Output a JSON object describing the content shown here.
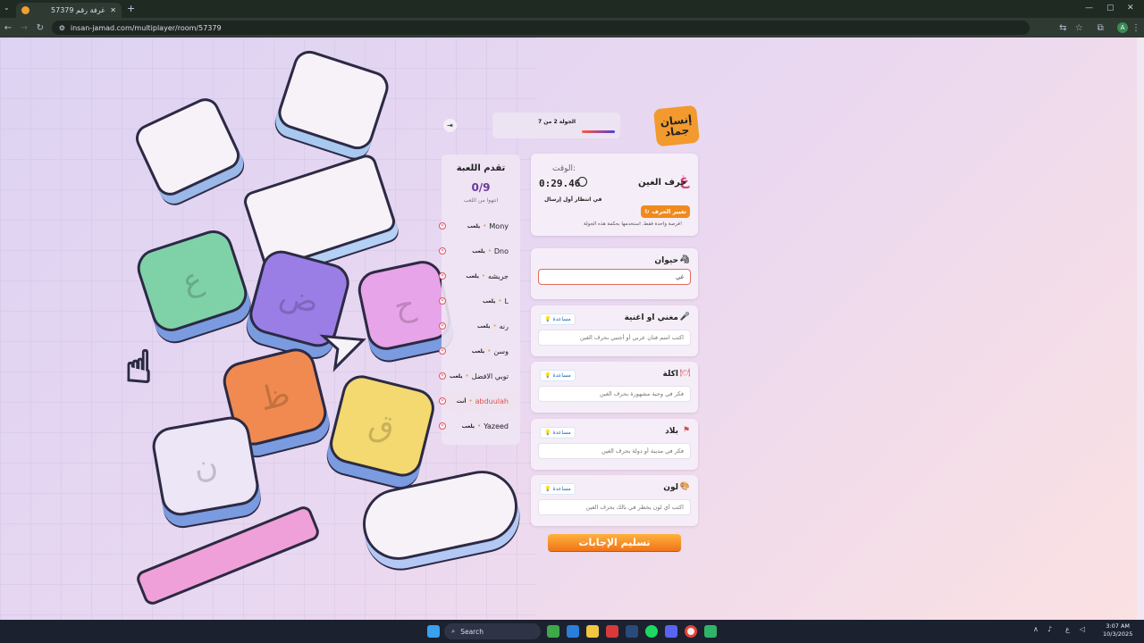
{
  "browser": {
    "tab_title": "غرفة رقم 57379",
    "url": "insan-jamad.com/multiplayer/room/57379",
    "avatar": "A"
  },
  "game": {
    "logo": "إنسان جماد",
    "round_label": "الجولة 2 من 7",
    "progress_title": "تقدم اللعبة",
    "progress_count": "0/9",
    "progress_sub": "انتهوا من اللعب",
    "players": [
      {
        "name": "Mony",
        "status": "يلعب"
      },
      {
        "name": "Dno",
        "status": "يلعب"
      },
      {
        "name": "جريشه",
        "status": "يلعب"
      },
      {
        "name": "L",
        "status": "يلعب"
      },
      {
        "name": "رنه",
        "status": "يلعب"
      },
      {
        "name": "وسن",
        "status": "يلعب"
      },
      {
        "name": "توبي الافضل",
        "status": "يلعب"
      },
      {
        "name": "abduulah",
        "status": "أنت"
      },
      {
        "name": "Yazeed",
        "status": "يلعب"
      }
    ],
    "time_label": "الوقت:",
    "time_value": "0:29.46",
    "letter_glyph": "غ",
    "letter_name": "حرف الغين",
    "waiting_text": "في انتظار أول إرسال",
    "change_letter": "تغيير الحرف",
    "change_note": "فرصة واحدة فقط. استخدمها بحكمة هذه الجولة!",
    "help_label": "مساعدة",
    "categories": [
      {
        "name": "حيوان",
        "value": "غي",
        "placeholder": ""
      },
      {
        "name": "مغني او اغنية",
        "value": "",
        "placeholder": "اكتب اسم فنان عربي أو أجنبي بحرف الغين"
      },
      {
        "name": "اكلة",
        "value": "",
        "placeholder": "فكر في وجبة مشهورة بحرف الغين"
      },
      {
        "name": "بلاد",
        "value": "",
        "placeholder": "فكر في مدينة أو دولة بحرف الغين"
      },
      {
        "name": "لون",
        "value": "",
        "placeholder": "اكتب أي لون يخطر في بالك بحرف الغين"
      }
    ],
    "submit_label": "تسليم الإجابات"
  },
  "taskbar": {
    "search": "Search",
    "time": "3:07 AM",
    "date": "10/3/2025",
    "lang": "ع"
  },
  "colors": {
    "accent": "#f08a1c",
    "letter": "#d6457a",
    "bg": "#ead8f1"
  },
  "keys": [
    "ع",
    "ض",
    "ح",
    "ظ",
    "ق",
    "ن"
  ]
}
